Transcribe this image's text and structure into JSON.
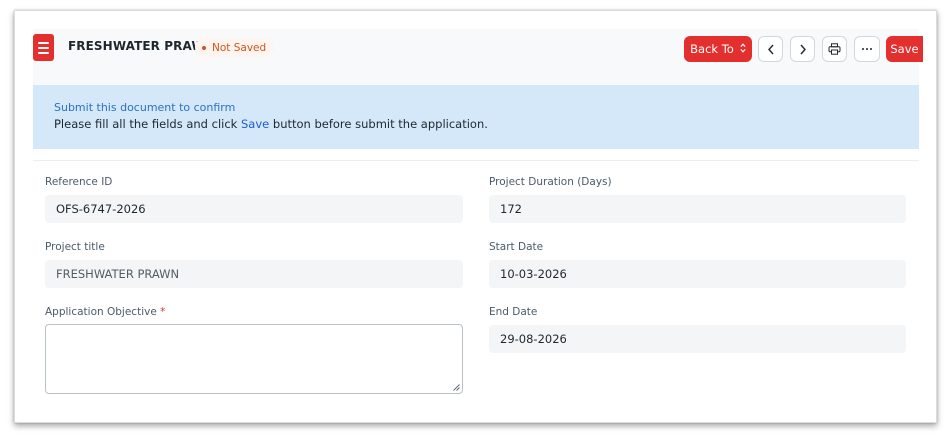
{
  "header": {
    "title": "FRESHWATER PRAWN",
    "status_badge": "Not Saved",
    "back_to_label": "Back To",
    "save_label": "Save"
  },
  "alert": {
    "title": "Submit this document to confirm",
    "message_before": "Please fill all the fields and click ",
    "message_link": "Save",
    "message_after": " button before submit the application."
  },
  "form": {
    "reference_id": {
      "label": "Reference ID",
      "value": "OFS-6747-2026"
    },
    "project_title": {
      "label": "Project title",
      "value": "FRESHWATER PRAWN"
    },
    "application_objective": {
      "label": "Application Objective",
      "required_mark": "*",
      "value": ""
    },
    "project_duration": {
      "label": "Project Duration (Days)",
      "value": "172"
    },
    "start_date": {
      "label": "Start Date",
      "value": "10-03-2026"
    },
    "end_date": {
      "label": "End Date",
      "value": "29-08-2026"
    }
  },
  "colors": {
    "primary_red": "#e3302f",
    "alert_background": "#d4e8fa",
    "badge_text": "#d0551a",
    "link_blue": "#1e5cdb"
  },
  "icons": [
    "hamburger-menu-icon",
    "status-dot-icon",
    "sort-icon",
    "chevron-left-icon",
    "chevron-right-icon",
    "printer-icon",
    "ellipsis-icon",
    "resize-grip-icon"
  ]
}
